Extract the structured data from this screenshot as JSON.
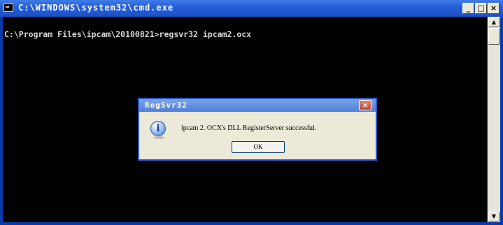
{
  "window": {
    "title": "C:\\WINDOWS\\system32\\cmd.exe",
    "controls": {
      "minimize": "_",
      "maximize": "□",
      "close": "×"
    }
  },
  "console": {
    "prompt_line": "C:\\Program Files\\ipcam\\20100821>regsvr32 ipcam2.ocx"
  },
  "scrollbar": {
    "up": "▲",
    "down": "▼"
  },
  "dialog": {
    "title": "RegSvr32",
    "close_label": "×",
    "icon": "information-icon",
    "icon_glyph": "i",
    "message": "ipcam 2. OCX's DLL RegisterServer successful.",
    "ok_label": "OK"
  }
}
